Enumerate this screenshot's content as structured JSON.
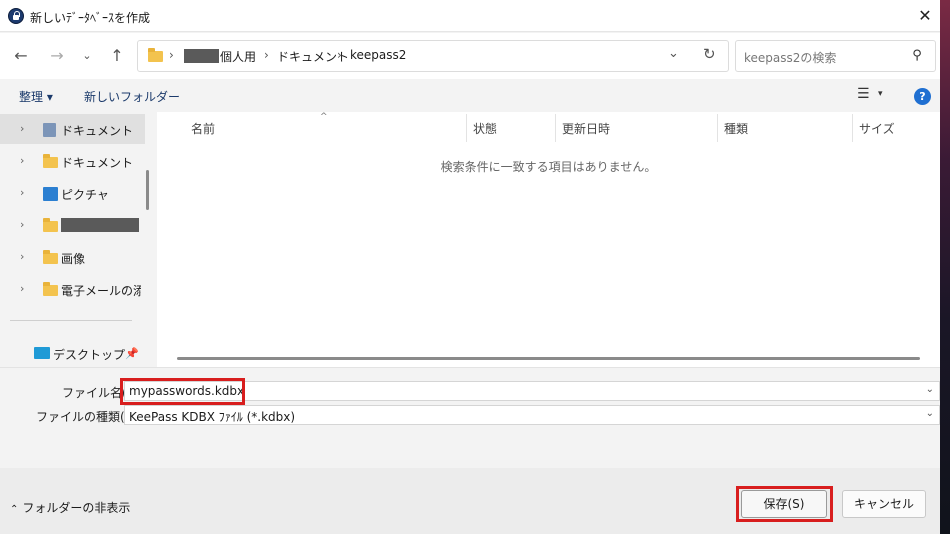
{
  "window": {
    "title": "新しいﾃﾞｰﾀﾍﾞｰｽを作成"
  },
  "address": {
    "crumbs": [
      "個人用",
      "ドキュメント",
      "keepass2"
    ],
    "separator": "›"
  },
  "search": {
    "placeholder": "keepass2の検索"
  },
  "commands": {
    "organize": "整理 ▾",
    "new_folder": "新しいフォルダー"
  },
  "nav": {
    "items": [
      {
        "label": "ドキュメント",
        "icon": "document-icon",
        "selected": true
      },
      {
        "label": "ドキュメント",
        "icon": "folder-icon"
      },
      {
        "label": "ピクチャ",
        "icon": "pictures-icon"
      },
      {
        "label": "",
        "icon": "folder-icon",
        "redacted": true
      },
      {
        "label": "画像",
        "icon": "folder-icon"
      },
      {
        "label": "電子メールの添付",
        "icon": "folder-icon"
      }
    ],
    "pinned": [
      {
        "label": "デスクトップ",
        "icon": "desktop-icon"
      }
    ]
  },
  "columns": [
    "名前",
    "状態",
    "更新日時",
    "種類",
    "サイズ"
  ],
  "empty_message": "検索条件に一致する項目はありません。",
  "form": {
    "filename_label": "ファイル名(N):",
    "filename_value": "mypasswords.kdbx",
    "filetype_label": "ファイルの種類(T):",
    "filetype_value": "KeePass KDBX ﾌｧｲﾙ (*.kdbx)"
  },
  "footer": {
    "hide_folders": "フォルダーの非表示",
    "save": "保存(S)",
    "cancel": "キャンセル"
  },
  "colors": {
    "accent": "#1f6fd1",
    "highlight_box": "#d81e1e",
    "folder": "#f3c34e"
  }
}
